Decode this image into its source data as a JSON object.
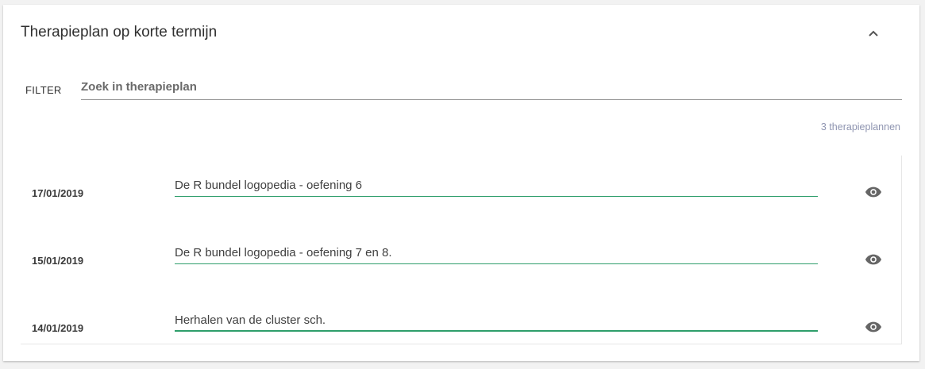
{
  "panel": {
    "title": "Therapieplan op korte termijn"
  },
  "filter": {
    "label": "FILTER",
    "placeholder": "Zoek in therapieplan",
    "value": ""
  },
  "summary": {
    "count_text": "3 therapieplannen"
  },
  "plans": [
    {
      "date": "17/01/2019",
      "text": "De R bundel logopedia - oefening 6"
    },
    {
      "date": "15/01/2019",
      "text": "De R bundel logopedia - oefening 7 en 8."
    },
    {
      "date": "14/01/2019",
      "text": "Herhalen van de cluster sch."
    }
  ],
  "icons": {
    "collapse": "chevron-up-icon",
    "view": "eye-icon"
  },
  "colors": {
    "accent_green": "#2e9e6b",
    "count_text": "#8e94b0",
    "icon_gray": "#666666"
  }
}
